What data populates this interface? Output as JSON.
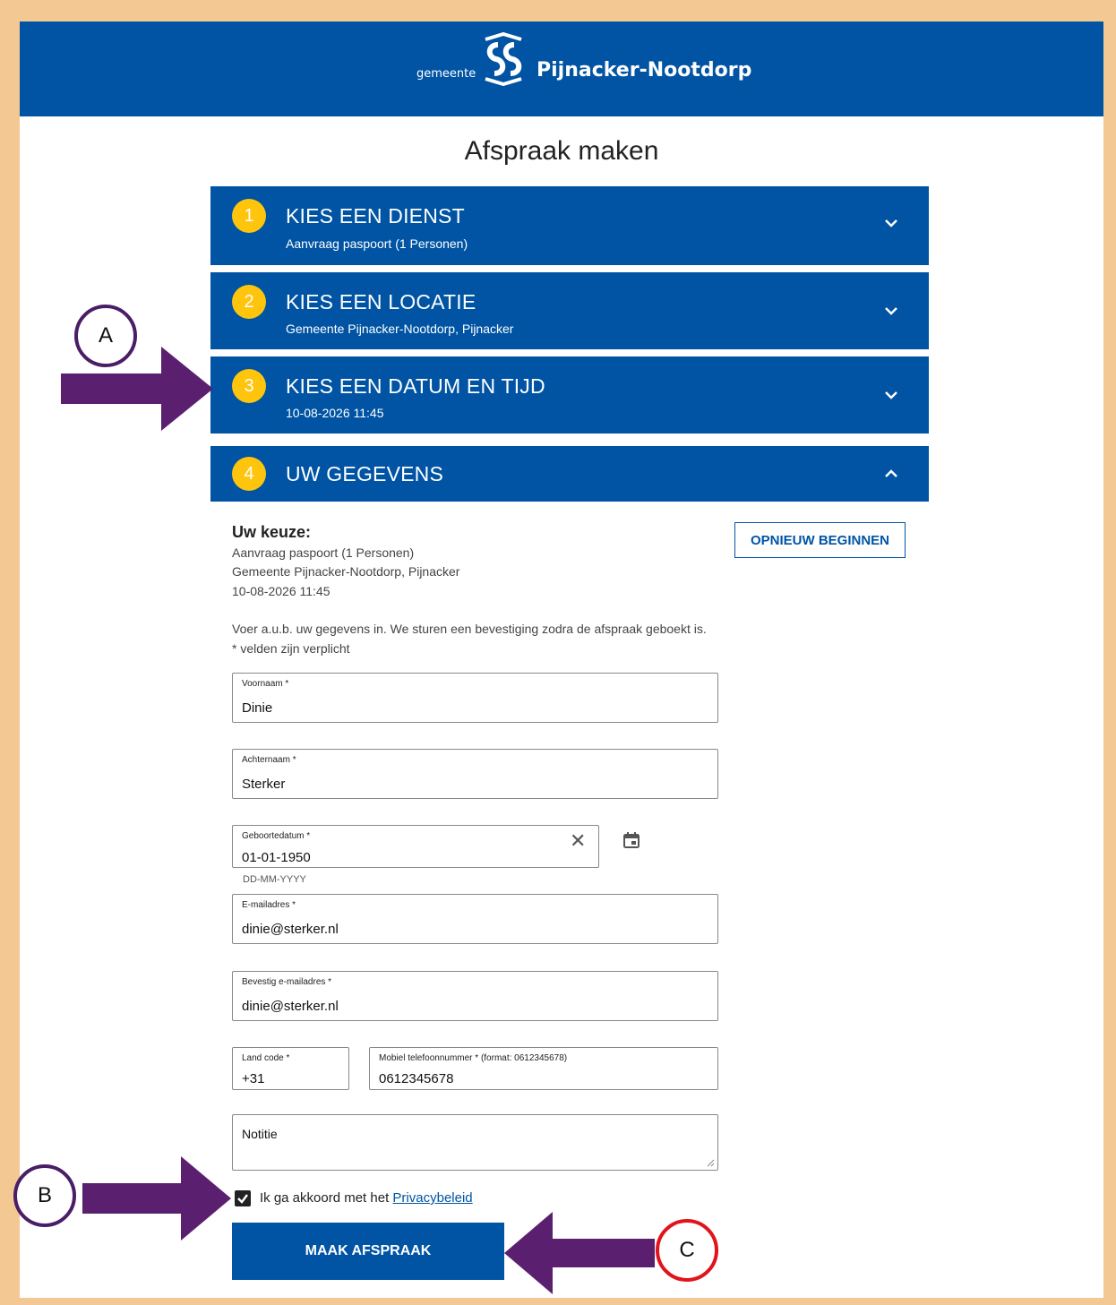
{
  "header": {
    "gemeente": "gemeente",
    "name": "Pijnacker-Nootdorp"
  },
  "page_title": "Afspraak maken",
  "steps": [
    {
      "num": "1",
      "title": "KIES EEN DIENST",
      "sub": "Aanvraag paspoort (1 Personen)"
    },
    {
      "num": "2",
      "title": "KIES EEN LOCATIE",
      "sub": "Gemeente Pijnacker-Nootdorp, Pijnacker"
    },
    {
      "num": "3",
      "title": "KIES EEN DATUM EN TIJD",
      "sub": "10-08-2026 11:45"
    },
    {
      "num": "4",
      "title": "UW GEGEVENS",
      "sub": ""
    }
  ],
  "keuze": {
    "heading": "Uw keuze:",
    "lines": [
      "Aanvraag paspoort (1 Personen)",
      "Gemeente Pijnacker-Nootdorp, Pijnacker",
      "10-08-2026 11:45"
    ],
    "restart_label": "OPNIEUW BEGINNEN"
  },
  "info": {
    "line1": "Voer a.u.b. uw gegevens in. We sturen een bevestiging zodra de afspraak geboekt is.",
    "line2": "* velden zijn verplicht"
  },
  "form": {
    "voornaam": {
      "label": "Voornaam *",
      "value": "Dinie"
    },
    "achternaam": {
      "label": "Achternaam *",
      "value": "Sterker"
    },
    "geboortedatum": {
      "label": "Geboortedatum *",
      "value": "01-01-1950",
      "hint": "DD-MM-YYYY"
    },
    "email": {
      "label": "E-mailadres *",
      "value": "dinie@sterker.nl"
    },
    "email_confirm": {
      "label": "Bevestig e-mailadres *",
      "value": "dinie@sterker.nl"
    },
    "landcode": {
      "label": "Land code *",
      "value": "+31"
    },
    "mobiel": {
      "label": "Mobiel telefoonnummer * (format: 0612345678)",
      "value": "0612345678"
    },
    "notitie": {
      "placeholder": "Notitie"
    }
  },
  "consent": {
    "text": "Ik ga akkoord met het",
    "link": "Privacybeleid",
    "checked": true
  },
  "submit_label": "MAAK AFSPRAAK",
  "callouts": {
    "a": "A",
    "b": "B",
    "c": "C"
  },
  "colors": {
    "brand_blue": "#0054a3",
    "step_yellow": "#ffc40c",
    "arrow_purple": "#5b1f70",
    "callout_red": "#e0141b",
    "border_tan": "#f3c893"
  }
}
